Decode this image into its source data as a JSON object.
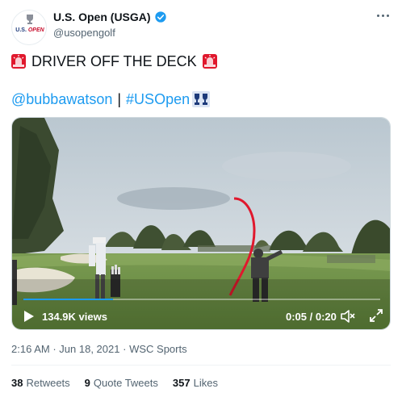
{
  "account": {
    "name": "U.S. Open (USGA)",
    "handle": "@usopengolf",
    "avatar_text_us": "U.S.",
    "avatar_text_open": "OPEN",
    "verified": true
  },
  "tweet": {
    "line1": "DRIVER OFF THE DECK",
    "mention": "@bubbawatson",
    "separator": "|",
    "hashtag": "#USOpen",
    "emojis": [
      "siren-emoji",
      "trophy-hashflag"
    ]
  },
  "video": {
    "views": "134.9K views",
    "time": "0:05 / 0:20",
    "progress": 0.25
  },
  "meta": {
    "time": "2:16 AM",
    "dot1": "·",
    "date": "Jun 18, 2021",
    "dot2": "·",
    "source": "WSC Sports"
  },
  "stats": {
    "retweets_count": "38",
    "retweets_label": "Retweets",
    "quotes_count": "9",
    "quotes_label": "Quote Tweets",
    "likes_count": "357",
    "likes_label": "Likes"
  },
  "colors": {
    "link": "#1d9bf0",
    "text": "#0f1419",
    "secondary": "#536471",
    "tracer": "#e0182d"
  }
}
